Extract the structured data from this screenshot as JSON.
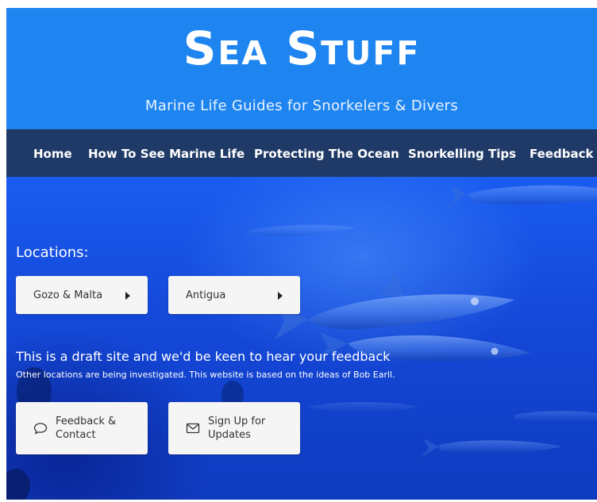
{
  "header": {
    "logo_text": "Sea Stuff",
    "tagline": "Marine Life Guides for Snorkelers & Divers"
  },
  "nav": {
    "items": [
      {
        "label": "Home"
      },
      {
        "label": "How To See Marine Life"
      },
      {
        "label": "Protecting The Ocean"
      },
      {
        "label": "Snorkelling Tips"
      },
      {
        "label": "Feedback"
      }
    ]
  },
  "main": {
    "locations_label": "Locations:",
    "locations": [
      {
        "label": "Gozo & Malta",
        "icon": "caret-right-icon"
      },
      {
        "label": "Antigua",
        "icon": "caret-right-icon"
      }
    ],
    "draft_message": "This is a draft site and we'd be keen to hear your feedback",
    "info_message": "Other locations are being investigated. This website is based on the ideas of Bob Earll.",
    "actions": [
      {
        "label": "Feedback & Contact",
        "icon": "speech-bubble-icon"
      },
      {
        "label": "Sign Up for Updates",
        "icon": "envelope-icon"
      }
    ]
  },
  "colors": {
    "header_bg": "#1e85f0",
    "nav_bg": "#1f3a66",
    "ocean_blue": "#1a5cf0",
    "button_bg": "#f5f5f5"
  }
}
